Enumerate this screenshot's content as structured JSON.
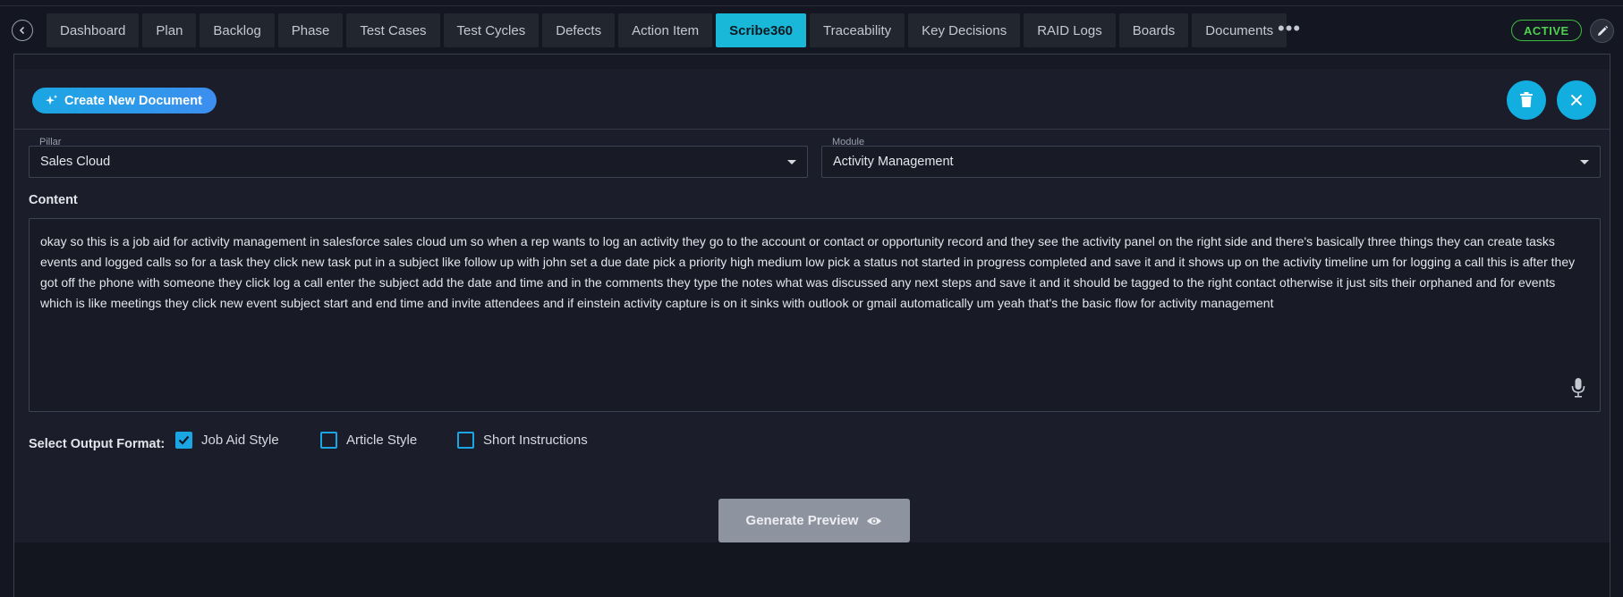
{
  "tabs": [
    {
      "label": "Dashboard"
    },
    {
      "label": "Plan"
    },
    {
      "label": "Backlog"
    },
    {
      "label": "Phase"
    },
    {
      "label": "Test Cases"
    },
    {
      "label": "Test Cycles"
    },
    {
      "label": "Defects"
    },
    {
      "label": "Action Item"
    },
    {
      "label": "Scribe360",
      "active": true
    },
    {
      "label": "Traceability"
    },
    {
      "label": "Key Decisions"
    },
    {
      "label": "RAID Logs"
    },
    {
      "label": "Boards"
    },
    {
      "label": "Documents"
    }
  ],
  "more_label": "•••",
  "status": {
    "label": "ACTIVE",
    "color": "#3dbb3d"
  },
  "header": {
    "create_label": "Create New Document"
  },
  "pillar": {
    "label": "Pillar",
    "value": "Sales Cloud"
  },
  "module": {
    "label": "Module",
    "value": "Activity Management"
  },
  "content": {
    "label": "Content",
    "text": "okay so this is a job aid for activity management in salesforce sales cloud um so when a rep wants to log an activity they go to the account or contact or opportunity record and they see the activity panel on the right side and there's basically three things they can create tasks events and logged calls so for a task they click new task put in a subject like follow up with john set a due date pick a priority high medium low pick a status not started in progress completed and save it and it shows up on the activity timeline um for logging a call this is after they got off the phone with someone they click log a call enter the subject add the date and time and in the comments they type the notes what was discussed any next steps and save it and it should be tagged to the right contact otherwise it just sits their orphaned and for events which is like meetings they click new event subject start and end time and invite attendees and if einstein activity capture is on it sinks with outlook or gmail automatically um yeah that's the basic flow for activity management"
  },
  "output_format": {
    "label": "Select Output Format:",
    "options": [
      {
        "label": "Job Aid Style",
        "checked": true
      },
      {
        "label": "Article Style",
        "checked": false
      },
      {
        "label": "Short Instructions",
        "checked": false
      }
    ]
  },
  "generate_label": "Generate Preview",
  "colors": {
    "accent": "#1ab8d8",
    "button_blue": "#12aee0",
    "bg": "#141722"
  }
}
